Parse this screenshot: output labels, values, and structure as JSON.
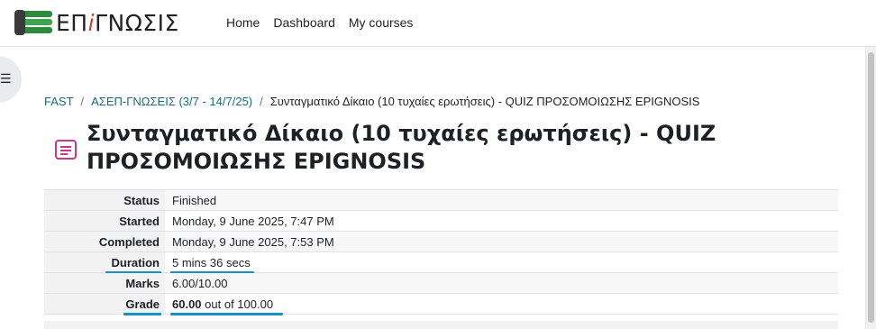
{
  "brand": {
    "prefix": "ΕΠ",
    "accent": "i",
    "suffix": "ΓΝΩΣΙΣ"
  },
  "nav": {
    "home": "Home",
    "dashboard": "Dashboard",
    "my_courses": "My courses"
  },
  "breadcrumb": {
    "items": [
      "FAST",
      "ΑΣΕΠ-ΓΝΩΣΕΙΣ (3/7 - 14/7/25)"
    ],
    "current": "Συνταγματικό Δίκαιο (10 τυχαίες ερωτήσεις) - QUIZ ΠΡΟΣΟΜΟΙΩΣΗΣ EPIGNOSIS",
    "separator": "/"
  },
  "page": {
    "title": "Συνταγματικό Δίκαιο (10 τυχαίες ερωτήσεις) - QUIZ ΠΡΟΣΟΜΟΙΩΣΗΣ EPIGNOSIS"
  },
  "summary": {
    "status": {
      "label": "Status",
      "value": "Finished"
    },
    "started": {
      "label": "Started",
      "value": "Monday, 9 June 2025, 7:47 PM"
    },
    "completed": {
      "label": "Completed",
      "value": "Monday, 9 June 2025, 7:53 PM"
    },
    "duration": {
      "label": "Duration",
      "value": "5 mins 36 secs"
    },
    "marks": {
      "label": "Marks",
      "value": "6.00/10.00"
    },
    "grade": {
      "label": "Grade",
      "value_bold": "60.00",
      "value_rest": " out of 100.00"
    }
  },
  "icons": {
    "drawer": "hamburger-icon",
    "quiz": "quiz-icon"
  },
  "colors": {
    "accent": "#1a8fc8",
    "quiz_icon": "#c8388b",
    "brand_green": "#2e8b3e",
    "brand_red": "#d93a2b"
  }
}
